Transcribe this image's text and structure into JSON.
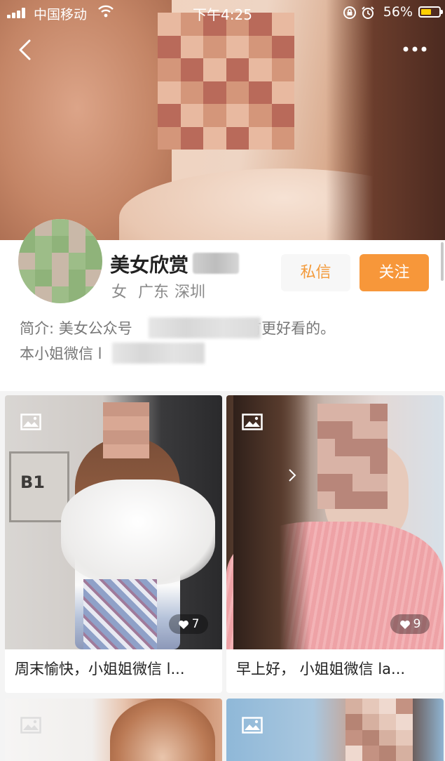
{
  "status_bar": {
    "carrier": "中国移动",
    "time": "下午4:25",
    "battery": "56%"
  },
  "profile": {
    "name": "美女欣赏",
    "gender": "女",
    "province": "广东",
    "city": "深圳",
    "bio_line1_prefix": "简介: 美女公众号",
    "bio_line1_suffix": "58 有更好看的。",
    "bio_line2": "本小姐微信 l",
    "message_button": "私信",
    "follow_button": "关注"
  },
  "posts": [
    {
      "caption": "周末愉快，小姐姐微信 l...",
      "likes": "7",
      "icon": "image-icon"
    },
    {
      "caption": "早上好， 小姐姐微信 la...",
      "likes": "9",
      "icon": "image-icon"
    },
    {
      "caption": "",
      "icon": "image-icon"
    },
    {
      "caption": "",
      "icon": "image-icon"
    }
  ],
  "colors": {
    "accent": "#f7973a",
    "message_text": "#f39a3a",
    "battery": "#ffd000"
  }
}
